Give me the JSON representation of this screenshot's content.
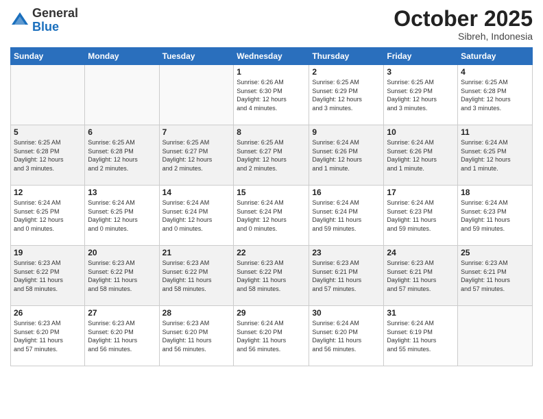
{
  "header": {
    "logo_general": "General",
    "logo_blue": "Blue",
    "month": "October 2025",
    "location": "Sibreh, Indonesia"
  },
  "weekdays": [
    "Sunday",
    "Monday",
    "Tuesday",
    "Wednesday",
    "Thursday",
    "Friday",
    "Saturday"
  ],
  "weeks": [
    [
      {
        "day": "",
        "info": ""
      },
      {
        "day": "",
        "info": ""
      },
      {
        "day": "",
        "info": ""
      },
      {
        "day": "1",
        "info": "Sunrise: 6:26 AM\nSunset: 6:30 PM\nDaylight: 12 hours\nand 4 minutes."
      },
      {
        "day": "2",
        "info": "Sunrise: 6:25 AM\nSunset: 6:29 PM\nDaylight: 12 hours\nand 3 minutes."
      },
      {
        "day": "3",
        "info": "Sunrise: 6:25 AM\nSunset: 6:29 PM\nDaylight: 12 hours\nand 3 minutes."
      },
      {
        "day": "4",
        "info": "Sunrise: 6:25 AM\nSunset: 6:28 PM\nDaylight: 12 hours\nand 3 minutes."
      }
    ],
    [
      {
        "day": "5",
        "info": "Sunrise: 6:25 AM\nSunset: 6:28 PM\nDaylight: 12 hours\nand 3 minutes."
      },
      {
        "day": "6",
        "info": "Sunrise: 6:25 AM\nSunset: 6:28 PM\nDaylight: 12 hours\nand 2 minutes."
      },
      {
        "day": "7",
        "info": "Sunrise: 6:25 AM\nSunset: 6:27 PM\nDaylight: 12 hours\nand 2 minutes."
      },
      {
        "day": "8",
        "info": "Sunrise: 6:25 AM\nSunset: 6:27 PM\nDaylight: 12 hours\nand 2 minutes."
      },
      {
        "day": "9",
        "info": "Sunrise: 6:24 AM\nSunset: 6:26 PM\nDaylight: 12 hours\nand 1 minute."
      },
      {
        "day": "10",
        "info": "Sunrise: 6:24 AM\nSunset: 6:26 PM\nDaylight: 12 hours\nand 1 minute."
      },
      {
        "day": "11",
        "info": "Sunrise: 6:24 AM\nSunset: 6:25 PM\nDaylight: 12 hours\nand 1 minute."
      }
    ],
    [
      {
        "day": "12",
        "info": "Sunrise: 6:24 AM\nSunset: 6:25 PM\nDaylight: 12 hours\nand 0 minutes."
      },
      {
        "day": "13",
        "info": "Sunrise: 6:24 AM\nSunset: 6:25 PM\nDaylight: 12 hours\nand 0 minutes."
      },
      {
        "day": "14",
        "info": "Sunrise: 6:24 AM\nSunset: 6:24 PM\nDaylight: 12 hours\nand 0 minutes."
      },
      {
        "day": "15",
        "info": "Sunrise: 6:24 AM\nSunset: 6:24 PM\nDaylight: 12 hours\nand 0 minutes."
      },
      {
        "day": "16",
        "info": "Sunrise: 6:24 AM\nSunset: 6:24 PM\nDaylight: 11 hours\nand 59 minutes."
      },
      {
        "day": "17",
        "info": "Sunrise: 6:24 AM\nSunset: 6:23 PM\nDaylight: 11 hours\nand 59 minutes."
      },
      {
        "day": "18",
        "info": "Sunrise: 6:24 AM\nSunset: 6:23 PM\nDaylight: 11 hours\nand 59 minutes."
      }
    ],
    [
      {
        "day": "19",
        "info": "Sunrise: 6:23 AM\nSunset: 6:22 PM\nDaylight: 11 hours\nand 58 minutes."
      },
      {
        "day": "20",
        "info": "Sunrise: 6:23 AM\nSunset: 6:22 PM\nDaylight: 11 hours\nand 58 minutes."
      },
      {
        "day": "21",
        "info": "Sunrise: 6:23 AM\nSunset: 6:22 PM\nDaylight: 11 hours\nand 58 minutes."
      },
      {
        "day": "22",
        "info": "Sunrise: 6:23 AM\nSunset: 6:22 PM\nDaylight: 11 hours\nand 58 minutes."
      },
      {
        "day": "23",
        "info": "Sunrise: 6:23 AM\nSunset: 6:21 PM\nDaylight: 11 hours\nand 57 minutes."
      },
      {
        "day": "24",
        "info": "Sunrise: 6:23 AM\nSunset: 6:21 PM\nDaylight: 11 hours\nand 57 minutes."
      },
      {
        "day": "25",
        "info": "Sunrise: 6:23 AM\nSunset: 6:21 PM\nDaylight: 11 hours\nand 57 minutes."
      }
    ],
    [
      {
        "day": "26",
        "info": "Sunrise: 6:23 AM\nSunset: 6:20 PM\nDaylight: 11 hours\nand 57 minutes."
      },
      {
        "day": "27",
        "info": "Sunrise: 6:23 AM\nSunset: 6:20 PM\nDaylight: 11 hours\nand 56 minutes."
      },
      {
        "day": "28",
        "info": "Sunrise: 6:23 AM\nSunset: 6:20 PM\nDaylight: 11 hours\nand 56 minutes."
      },
      {
        "day": "29",
        "info": "Sunrise: 6:24 AM\nSunset: 6:20 PM\nDaylight: 11 hours\nand 56 minutes."
      },
      {
        "day": "30",
        "info": "Sunrise: 6:24 AM\nSunset: 6:20 PM\nDaylight: 11 hours\nand 56 minutes."
      },
      {
        "day": "31",
        "info": "Sunrise: 6:24 AM\nSunset: 6:19 PM\nDaylight: 11 hours\nand 55 minutes."
      },
      {
        "day": "",
        "info": ""
      }
    ]
  ]
}
